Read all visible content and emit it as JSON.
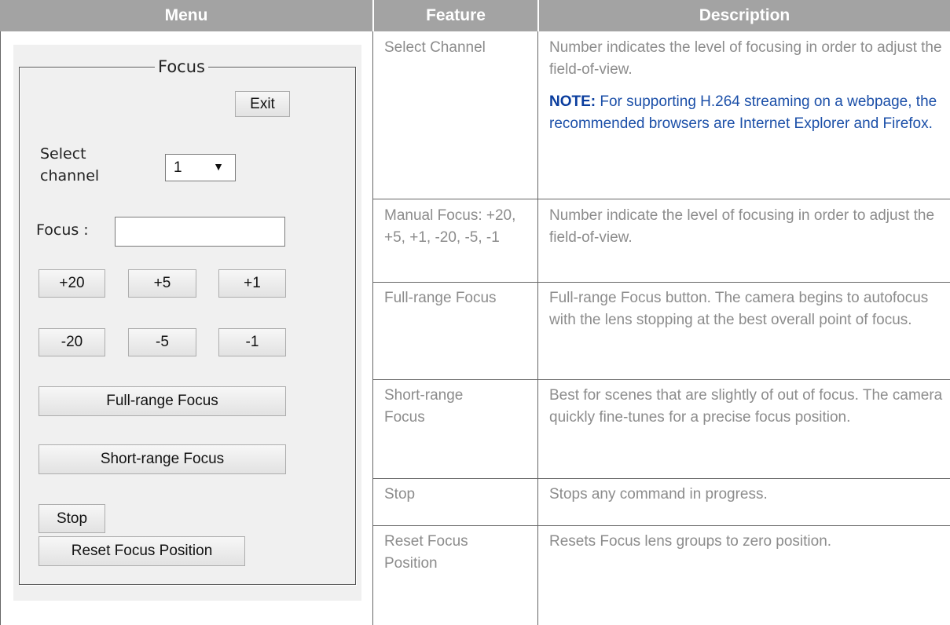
{
  "headers": {
    "menu": "Menu",
    "feature": "Feature",
    "description": "Description"
  },
  "panel": {
    "legend": "Focus",
    "exit_label": "Exit",
    "select_channel_label": "Select channel",
    "select_channel_value": "1",
    "select_arrow": "▼",
    "focus_label": "Focus :",
    "focus_value": "",
    "plus20": "+20",
    "plus5": "+5",
    "plus1": "+1",
    "minus20": "-20",
    "minus5": "-5",
    "minus1": "-1",
    "full_range": "Full-range Focus",
    "short_range": "Short-range Focus",
    "stop": "Stop",
    "reset": "Reset Focus Position"
  },
  "rows": [
    {
      "feature": "Select Channel",
      "description": "Number indicates the level of focusing in order to adjust the field-of-view.",
      "note_label": "NOTE:",
      "note_text": " For supporting H.264 streaming on a webpage, the recommended browsers are Internet Explorer and Firefox."
    },
    {
      "feature": "Manual Focus: +20, +5, +1, -20, -5, -1",
      "description": "Number indicate the level of focusing in order to adjust the field-of-view."
    },
    {
      "feature": "Full-range Focus",
      "description": "Full-range Focus button. The camera begins to autofocus with the lens stopping at the best overall point of focus."
    },
    {
      "feature": "Short-range Focus",
      "description": "Best for scenes that are slightly of out of focus. The camera quickly fine-tunes for a precise focus position."
    },
    {
      "feature": "Stop",
      "description": "Stops any command in progress."
    },
    {
      "feature": "Reset Focus Position",
      "description": "Resets Focus lens groups to zero position."
    }
  ]
}
